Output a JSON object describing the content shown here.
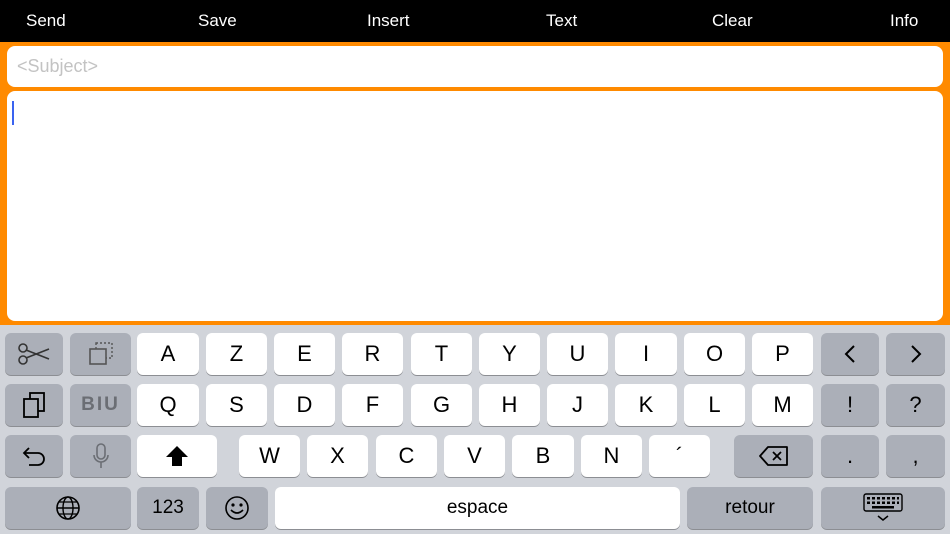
{
  "menu": {
    "send": "Send",
    "save": "Save",
    "insert": "Insert",
    "text": "Text",
    "clear": "Clear",
    "info": "Info"
  },
  "editor": {
    "subject_placeholder": "<Subject>",
    "subject_value": "",
    "body_value": ""
  },
  "keyboard": {
    "row1": [
      "A",
      "Z",
      "E",
      "R",
      "T",
      "Y",
      "U",
      "I",
      "O",
      "P"
    ],
    "row2": [
      "Q",
      "S",
      "D",
      "F",
      "G",
      "H",
      "J",
      "K",
      "L",
      "M"
    ],
    "row3": [
      "W",
      "X",
      "C",
      "V",
      "B",
      "N",
      "´"
    ],
    "punct": {
      "excl": "!",
      "quest": "?",
      "period": ".",
      "comma": ","
    },
    "biu_label": "BIU",
    "numbers_label": "123",
    "space_label": "espace",
    "return_label": "retour",
    "icons": {
      "cut": "scissors-icon",
      "copy": "copy-icon",
      "paste": "paste-icon",
      "undo": "undo-icon",
      "dictation": "microphone-icon",
      "shift": "shift-icon",
      "delete": "delete-icon",
      "globe": "globe-icon",
      "emoji": "emoji-icon",
      "dismiss": "keyboard-dismiss-icon",
      "left": "chevron-left-icon",
      "right": "chevron-right-icon"
    }
  },
  "colors": {
    "accent": "#ff8a00",
    "menubar": "#000000",
    "keyboard_bg": "#d1d4da",
    "key_dark": "#abafb8",
    "caret": "#3a63f0"
  }
}
